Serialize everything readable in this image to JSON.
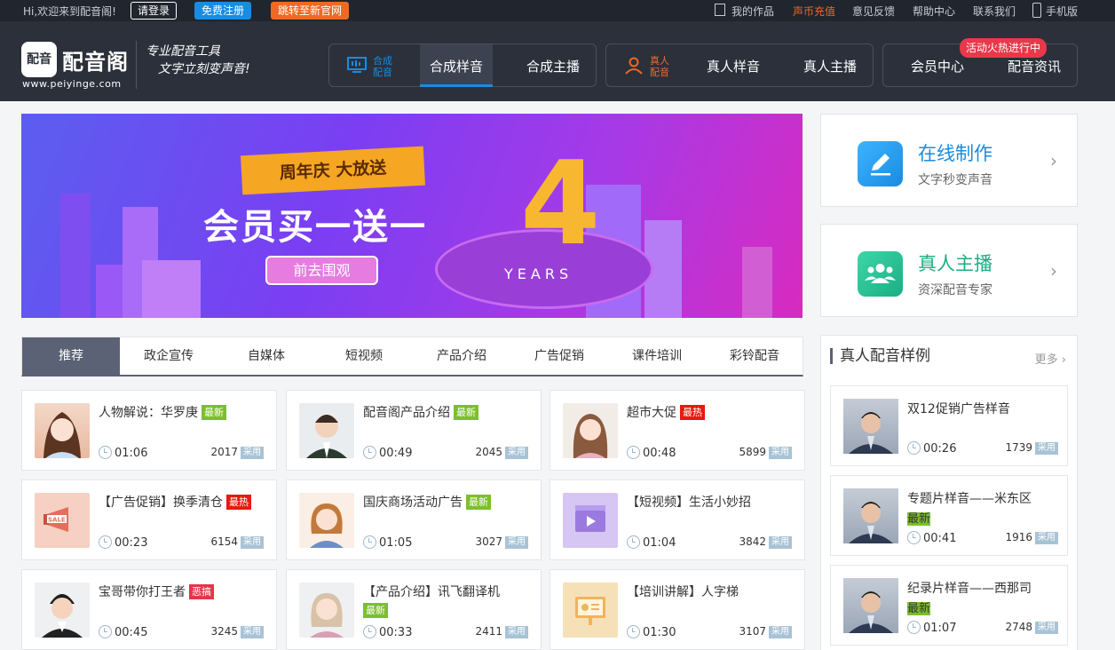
{
  "topbar": {
    "greeting": "Hi,欢迎来到配音阁!",
    "login": "请登录",
    "register": "免费注册",
    "jump": "跳转至新官网",
    "links": [
      "我的作品",
      "声币充值",
      "意见反馈",
      "帮助中心",
      "联系我们",
      "手机版"
    ]
  },
  "header": {
    "logo_mark": "配音",
    "logo_name": "配音阁",
    "logo_url": "www.peiyinge.com",
    "slogan_line1": "专业配音工具",
    "slogan_line2": "文字立刻变声音!",
    "group1_label": "合成配音",
    "group1_items": [
      "合成样音",
      "合成主播"
    ],
    "group2_label": "真人配音",
    "group2_items": [
      "真人样音",
      "真人主播"
    ],
    "group3_items": [
      "会员中心",
      "配音资讯"
    ],
    "hot_badge": "活动火热进行中"
  },
  "banner": {
    "ribbon": "周年庆 大放送",
    "promo": "会员买一送一",
    "cta": "前去围观",
    "big_number": "4",
    "years": "YEARS"
  },
  "side": {
    "online_title": "在线制作",
    "online_sub": "文字秒变声音",
    "host_title": "真人主播",
    "host_sub": "资深配音专家"
  },
  "tabs": [
    "推荐",
    "政企宣传",
    "自媒体",
    "短视频",
    "产品介绍",
    "广告促销",
    "课件培训",
    "彩铃配音"
  ],
  "cards": [
    {
      "title": "人物解说：华罗庚",
      "tag": "最新",
      "duration": "01:06",
      "count": "2017",
      "use": "采用"
    },
    {
      "title": "配音阁产品介绍",
      "tag": "最新",
      "duration": "00:49",
      "count": "2045",
      "use": "采用"
    },
    {
      "title": "超市大促",
      "tag": "最热",
      "duration": "00:48",
      "count": "5899",
      "use": "采用"
    },
    {
      "title": "【广告促销】换季清仓",
      "tag": "最热",
      "duration": "00:23",
      "count": "6154",
      "use": "采用"
    },
    {
      "title": "国庆商场活动广告",
      "tag": "最新",
      "duration": "01:05",
      "count": "3027",
      "use": "采用"
    },
    {
      "title": "【短视频】生活小妙招",
      "tag": "",
      "duration": "01:04",
      "count": "3842",
      "use": "采用"
    },
    {
      "title": "宝哥带你打王者",
      "tag": "恶搞",
      "duration": "00:45",
      "count": "3245",
      "use": "采用"
    },
    {
      "title": "【产品介绍】讯飞翻译机",
      "tag": "最新",
      "duration": "00:33",
      "count": "2411",
      "use": "采用"
    },
    {
      "title": "【培训讲解】人字梯",
      "tag": "",
      "duration": "01:30",
      "count": "3107",
      "use": "采用"
    }
  ],
  "samples": {
    "heading": "真人配音样例",
    "more": "更多",
    "items": [
      {
        "title": "双12促销广告样音",
        "tag": "",
        "duration": "00:26",
        "count": "1739",
        "use": "采用"
      },
      {
        "title": "专题片样音——米东区",
        "tag": "最新",
        "duration": "00:41",
        "count": "1916",
        "use": "采用"
      },
      {
        "title": "纪录片样音——西那司",
        "tag": "最新",
        "duration": "01:07",
        "count": "2748",
        "use": "采用"
      }
    ]
  },
  "colors": {
    "accent": "#1a8be0",
    "orange": "#ee6a24",
    "header_bg": "#2b303b",
    "new_tag": "#7cbf2c",
    "hot_tag": "#e8190f"
  }
}
